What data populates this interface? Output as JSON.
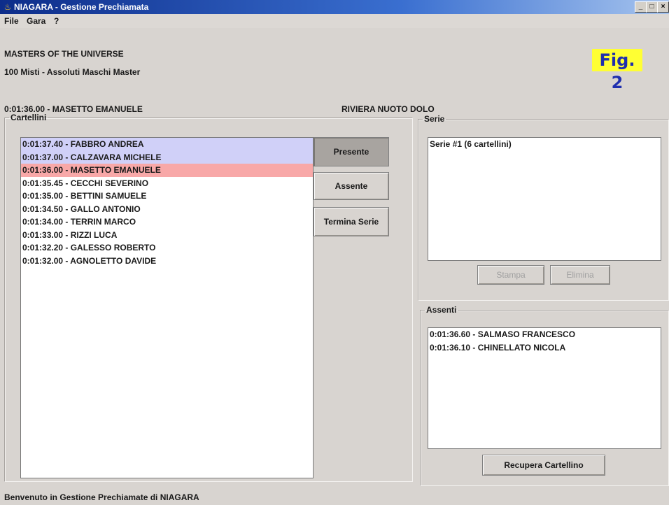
{
  "window": {
    "title": "NIAGARA - Gestione Prechiamata",
    "icon": "coffee-cup-icon",
    "buttons": [
      "_",
      "□",
      "×"
    ]
  },
  "menu": [
    "File",
    "Gara",
    "?"
  ],
  "header": {
    "event": "MASTERS OF THE UNIVERSE",
    "race": "100 Misti - Assoluti Maschi Master",
    "current_athlete": "0:01:36.00 - MASETTO EMANUELE",
    "current_team": "RIVIERA NUOTO DOLO",
    "fig_label": "Fig. 2"
  },
  "cartellini": {
    "title": "Cartellini",
    "items": [
      "0:01:37.40 - FABBRO ANDREA",
      "0:01:37.00 - CALZAVARA MICHELE",
      "0:01:36.00 - MASETTO EMANUELE",
      "0:01:35.45 - CECCHI SEVERINO",
      "0:01:35.00 - BETTINI SAMUELE",
      "0:01:34.50 - GALLO ANTONIO",
      "0:01:34.00 - TERRIN MARCO",
      "0:01:33.00 - RIZZI LUCA",
      "0:01:32.20 - GALESSO ROBERTO",
      "0:01:32.00 - AGNOLETTO DAVIDE"
    ],
    "selected_indices": [
      0,
      1
    ],
    "current_index": 2,
    "highlight_colors": {
      "selected": "#d0d0f8",
      "current": "#f8a8a8"
    }
  },
  "actions": {
    "presente": "Presente",
    "assente": "Assente",
    "termina": "Termina Serie"
  },
  "serie": {
    "title": "Serie",
    "items": [
      "Serie #1 (6 cartellini)"
    ],
    "stampa": "Stampa",
    "elimina": "Elimina"
  },
  "assenti": {
    "title": "Assenti",
    "items": [
      "0:01:36.60 - SALMASO FRANCESCO",
      "0:01:36.10 - CHINELLATO NICOLA"
    ],
    "recupera": "Recupera Cartellino"
  },
  "status": "Benvenuto in Gestione Prechiamate di NIAGARA"
}
